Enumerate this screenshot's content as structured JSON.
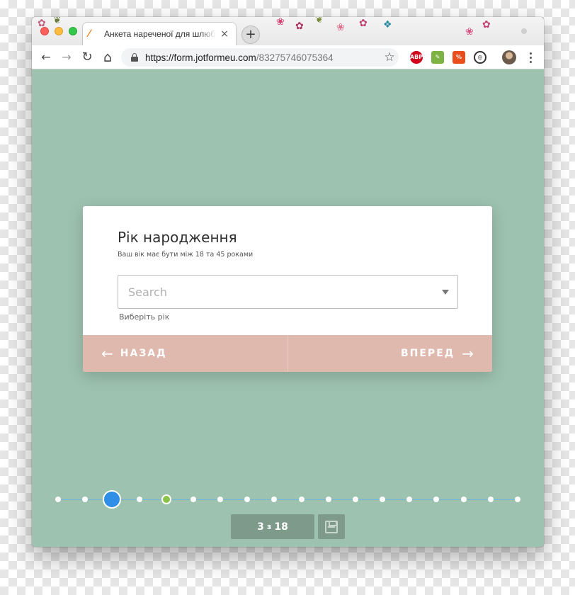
{
  "browser": {
    "tab_title": "Анкета нареченої для шлюбного агентства",
    "tab_close": "×",
    "new_tab": "+",
    "url_host": "https://form.jotformeu.com",
    "url_path": "/83275746075364",
    "icons": {
      "back": "←",
      "forward": "→",
      "reload": "↻",
      "home": "⌂",
      "bookmark": "☆"
    },
    "extensions": [
      {
        "name": "ABP",
        "color": "#d0021b"
      },
      {
        "name": "evernote",
        "color": "#7cb342"
      },
      {
        "name": "honey",
        "color": "#e94e1b"
      },
      {
        "name": "momentum",
        "color": "#333333"
      }
    ]
  },
  "form": {
    "question_title": "Рік народження",
    "question_subtitle": "Ваш вік має бути між 18 та 45 роками",
    "select_placeholder": "Search",
    "select_hint": "Виберіть рік",
    "back_label": "НАЗАД",
    "next_label": "ВПЕРЕД",
    "back_arrow": "←",
    "next_arrow": "→",
    "accent_color": "#dfb9ad",
    "background_color": "#9ec2b0"
  },
  "progress": {
    "current_page": "3",
    "separator": "з",
    "total_pages": "18",
    "current_step": 3,
    "completed_steps": [
      5
    ],
    "total_steps": 18
  }
}
